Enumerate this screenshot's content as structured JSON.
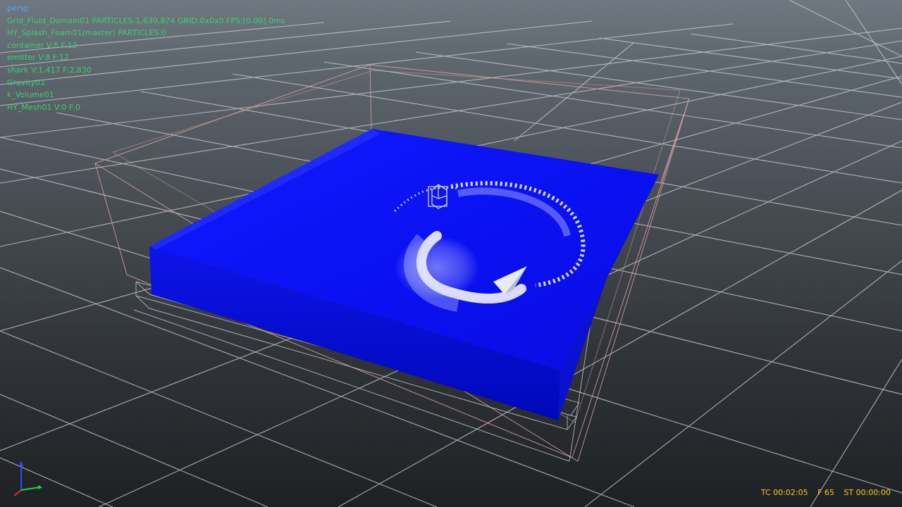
{
  "viewport": {
    "camera_name": "persp"
  },
  "hud_lines": [
    "Grid_Fluid_Domain01 PARTICLES:1,630,874 GRID:0x0x0 FPS:[0.00] 0ms",
    "HY_Splash_Foam01(master) PARTICLES:0",
    "container V:8 F:12",
    "emitter V:8 F:12",
    "shark V:1,417 F:2,830",
    "Gravity01",
    "k_Volume01",
    "HY_Mesh01 V:0 F:0"
  ],
  "status": {
    "timecode": "TC 00:02:05",
    "frame": "F 65",
    "start_time": "ST 00:00:00"
  },
  "colors": {
    "fluid": "#0a10f5",
    "foam": "#ffffff",
    "grid_line": "#c8ccd0",
    "bounding_box": "#d9a0a0",
    "hud_text": "#3bd06f",
    "camera_text": "#4ea8ff",
    "timecode_text": "#f2d21a"
  },
  "axis_gizmo": {
    "axes": [
      "y-axis",
      "x-axis",
      "z-axis"
    ],
    "colors": [
      "#2a4cff",
      "#24d04a",
      "#e23030"
    ]
  }
}
